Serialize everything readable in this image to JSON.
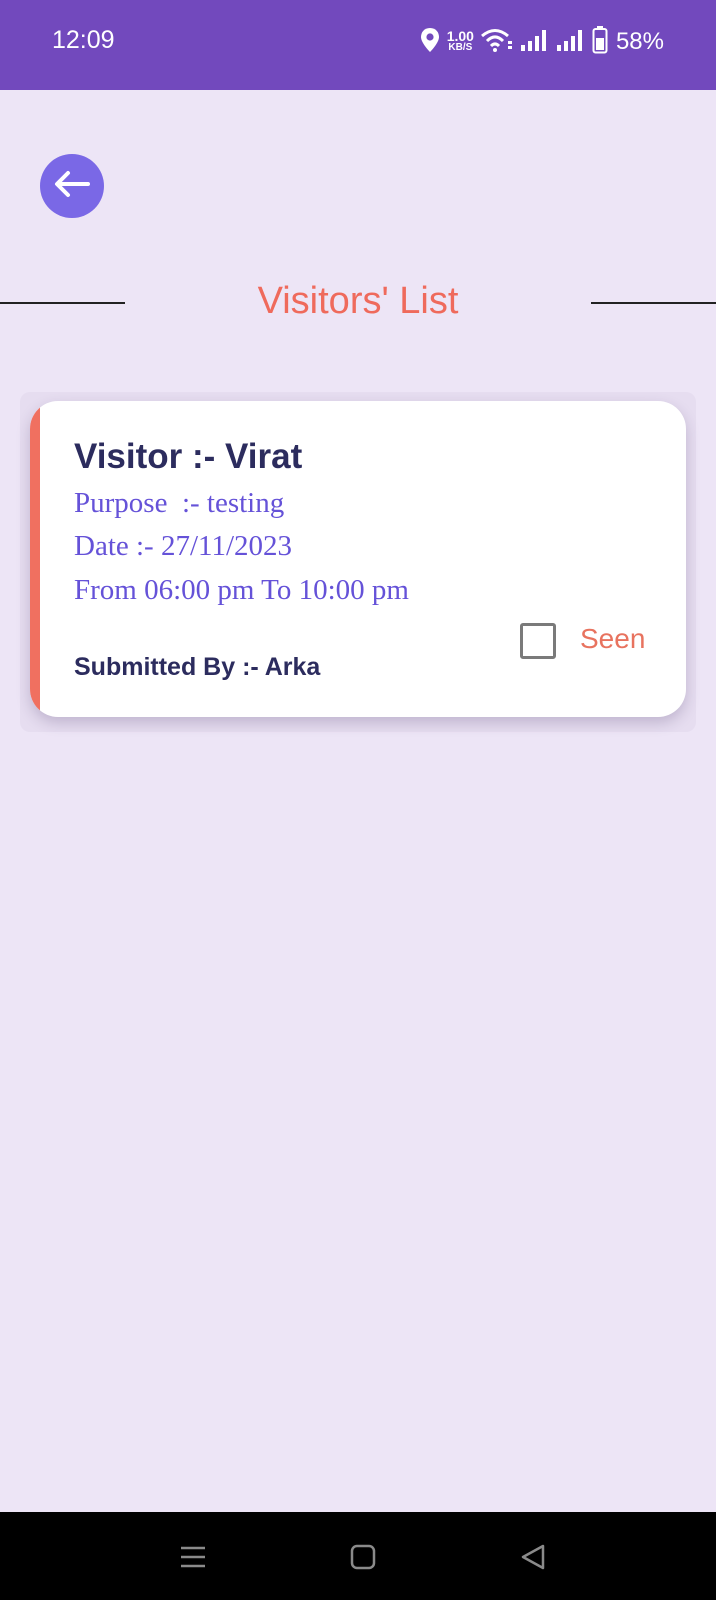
{
  "status_bar": {
    "time": "12:09",
    "net_speed_value": "1.00",
    "net_speed_unit": "KB/S",
    "battery": "58%"
  },
  "header": {
    "back_icon": "arrow-left-icon",
    "title": "Visitors' List"
  },
  "visitors": [
    {
      "name_line": "Visitor :- Virat",
      "purpose_line": "Purpose  :- testing",
      "date_line": "Date :- 27/11/2023",
      "time_line": "From 06:00 pm To 10:00 pm",
      "submitted_line": "Submitted By :- Arka",
      "seen_label": "Seen",
      "seen_checked": false
    }
  ],
  "colors": {
    "status_bar": "#7249bd",
    "background": "#ede5f6",
    "accent": "#f07060",
    "back_button": "#7a68e6",
    "title": "#ef6a5c",
    "name_text": "#2c2c5e",
    "detail_text": "#6552d8"
  },
  "nav_bar": {
    "icons": [
      "recent-apps-icon",
      "home-icon",
      "back-triangle-icon"
    ]
  }
}
